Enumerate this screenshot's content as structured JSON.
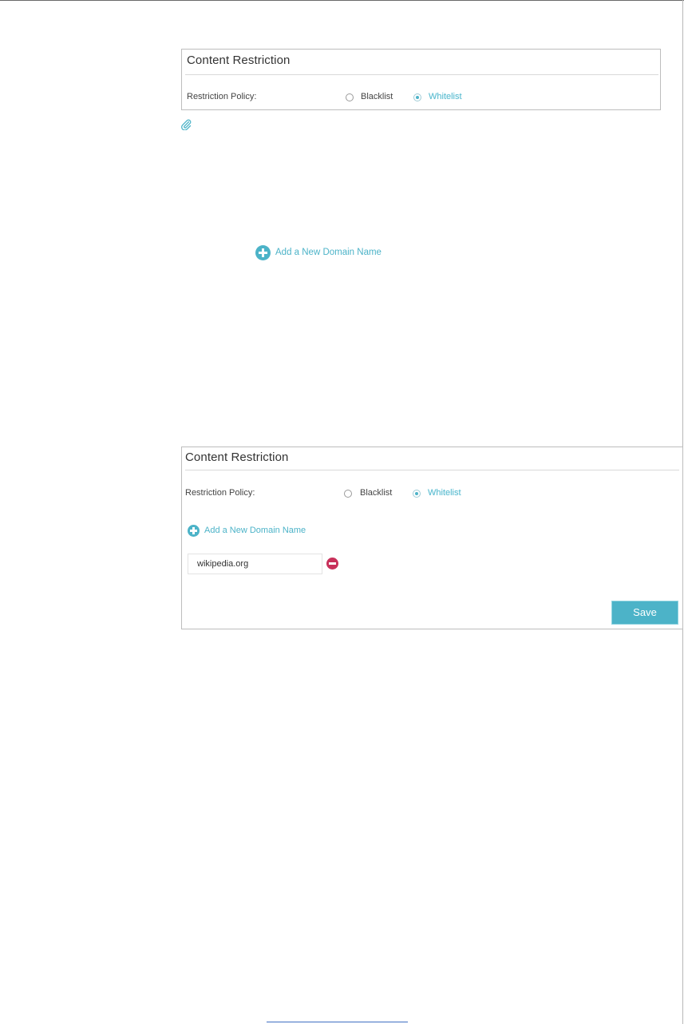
{
  "panel_top": {
    "title": "Content Restriction",
    "policy_label": "Restriction Policy:",
    "option_blacklist": "Blacklist",
    "option_whitelist": "Whitelist",
    "selected": "Whitelist"
  },
  "add_domain_link": "Add a New Domain Name",
  "panel_bottom": {
    "title": "Content Restriction",
    "policy_label": "Restriction Policy:",
    "option_blacklist": "Blacklist",
    "option_whitelist": "Whitelist",
    "selected": "Whitelist",
    "add_domain_label": "Add a New Domain Name",
    "domain_value": "wikipedia.org",
    "save_label": "Save"
  },
  "icons": {
    "note": "paperclip-icon",
    "add": "plus-circle-icon",
    "remove": "minus-circle-icon"
  },
  "colors": {
    "accent": "#4cb3c8",
    "remove": "#c8305a",
    "border": "#bdbdbd"
  }
}
